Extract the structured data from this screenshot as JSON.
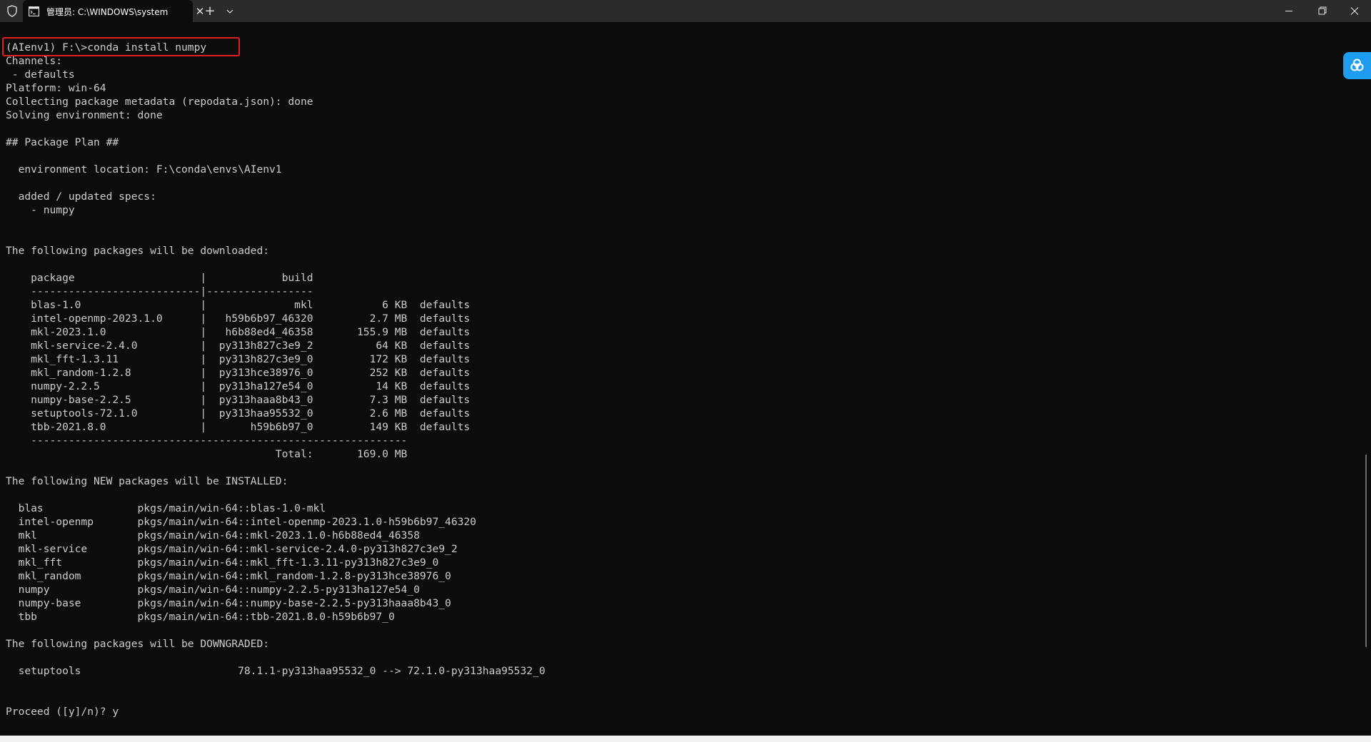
{
  "window": {
    "tab_title": "管理员: C:\\WINDOWS\\system",
    "tab_close_glyph": "✕",
    "new_tab_glyph": "+"
  },
  "terminal": {
    "lines": [
      "(AIenv1) F:\\>conda install numpy",
      "Channels:",
      " - defaults",
      "Platform: win-64",
      "Collecting package metadata (repodata.json): done",
      "Solving environment: done",
      "",
      "## Package Plan ##",
      "",
      "  environment location: F:\\conda\\envs\\AIenv1",
      "",
      "  added / updated specs:",
      "    - numpy",
      "",
      "",
      "The following packages will be downloaded:",
      "",
      "    package                    |            build",
      "    ---------------------------|-----------------",
      "    blas-1.0                   |              mkl           6 KB  defaults",
      "    intel-openmp-2023.1.0      |   h59b6b97_46320         2.7 MB  defaults",
      "    mkl-2023.1.0               |   h6b88ed4_46358       155.9 MB  defaults",
      "    mkl-service-2.4.0          |  py313h827c3e9_2          64 KB  defaults",
      "    mkl_fft-1.3.11             |  py313h827c3e9_0         172 KB  defaults",
      "    mkl_random-1.2.8           |  py313hce38976_0         252 KB  defaults",
      "    numpy-2.2.5                |  py313ha127e54_0          14 KB  defaults",
      "    numpy-base-2.2.5           |  py313haaa8b43_0         7.3 MB  defaults",
      "    setuptools-72.1.0          |  py313haa95532_0         2.6 MB  defaults",
      "    tbb-2021.8.0               |       h59b6b97_0         149 KB  defaults",
      "    ------------------------------------------------------------",
      "                                           Total:       169.0 MB",
      "",
      "The following NEW packages will be INSTALLED:",
      "",
      "  blas               pkgs/main/win-64::blas-1.0-mkl",
      "  intel-openmp       pkgs/main/win-64::intel-openmp-2023.1.0-h59b6b97_46320",
      "  mkl                pkgs/main/win-64::mkl-2023.1.0-h6b88ed4_46358",
      "  mkl-service        pkgs/main/win-64::mkl-service-2.4.0-py313h827c3e9_2",
      "  mkl_fft            pkgs/main/win-64::mkl_fft-1.3.11-py313h827c3e9_0",
      "  mkl_random         pkgs/main/win-64::mkl_random-1.2.8-py313hce38976_0",
      "  numpy              pkgs/main/win-64::numpy-2.2.5-py313ha127e54_0",
      "  numpy-base         pkgs/main/win-64::numpy-base-2.2.5-py313haaa8b43_0",
      "  tbb                pkgs/main/win-64::tbb-2021.8.0-h59b6b97_0",
      "",
      "The following packages will be DOWNGRADED:",
      "",
      "  setuptools                         78.1.1-py313haa95532_0 --> 72.1.0-py313haa95532_0",
      "",
      "",
      "Proceed ([y]/n)? y"
    ]
  },
  "colors": {
    "terminal_bg": "#0c0c0c",
    "terminal_text": "#cccccc",
    "titlebar_bg": "#2b2b2b",
    "highlight_border": "#e02020",
    "float_button": "#1f9cf0"
  },
  "icons": {
    "shield": "shield-icon",
    "terminal": "terminal-icon",
    "close": "close-icon",
    "add": "plus-icon",
    "dropdown": "chevron-down-icon",
    "minimize": "minimize-icon",
    "restore": "restore-icon",
    "window_close": "window-close-icon",
    "assistant": "assistant-icon"
  }
}
